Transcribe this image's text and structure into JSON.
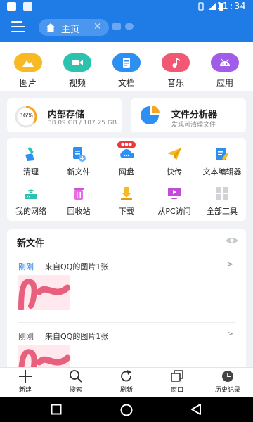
{
  "status_bar": {
    "time": "11:34"
  },
  "header": {
    "tab_label": "主页",
    "colors": {
      "primary": "#1f7be6"
    }
  },
  "categories": [
    {
      "label": "图片",
      "icon": "image-icon",
      "color": "#f7b924"
    },
    {
      "label": "视频",
      "icon": "video-icon",
      "color": "#2bc3ad"
    },
    {
      "label": "文档",
      "icon": "document-icon",
      "color": "#2e8ff2"
    },
    {
      "label": "音乐",
      "icon": "music-icon",
      "color": "#f25873"
    },
    {
      "label": "应用",
      "icon": "app-icon",
      "color": "#a15ce8"
    }
  ],
  "storage": {
    "title": "内部存储",
    "used": "38.09 GB / 107.25 GB",
    "percent_label": "36%",
    "percent": 36
  },
  "analyzer": {
    "title": "文件分析器",
    "subtitle": "发现可清理文件"
  },
  "tools": [
    {
      "label": "清理",
      "icon": "broom-icon"
    },
    {
      "label": "新文件",
      "icon": "new-file-icon"
    },
    {
      "label": "网盘",
      "icon": "cloud-drive-icon"
    },
    {
      "label": "快传",
      "icon": "paper-plane-icon"
    },
    {
      "label": "文本编辑器",
      "icon": "text-editor-icon"
    },
    {
      "label": "我的网络",
      "icon": "router-icon"
    },
    {
      "label": "回收站",
      "icon": "trash-icon"
    },
    {
      "label": "下载",
      "icon": "download-icon"
    },
    {
      "label": "从PC访问",
      "icon": "pc-icon"
    },
    {
      "label": "全部工具",
      "icon": "grid-icon"
    }
  ],
  "new_files": {
    "title": "新文件",
    "entries": [
      {
        "time": "刚刚",
        "description": "来自QQ的图片1张",
        "time_color": "#1f7be6"
      },
      {
        "time": "刚刚",
        "description": "来自QQ的图片1张",
        "time_color": "#555555"
      }
    ]
  },
  "toolbar": [
    {
      "label": "新建",
      "icon": "plus-icon"
    },
    {
      "label": "搜索",
      "icon": "search-icon"
    },
    {
      "label": "刷新",
      "icon": "refresh-icon"
    },
    {
      "label": "窗口",
      "icon": "windows-icon"
    },
    {
      "label": "历史记录",
      "icon": "history-icon"
    }
  ]
}
